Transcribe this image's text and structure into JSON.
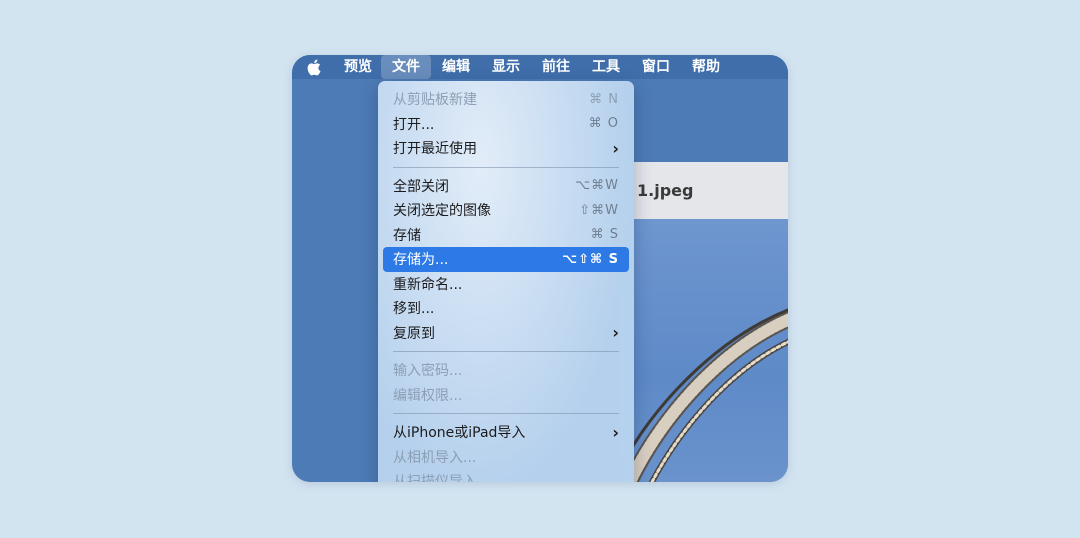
{
  "menubar": {
    "items": [
      "预览",
      "文件",
      "编辑",
      "显示",
      "前往",
      "工具",
      "窗口",
      "帮助"
    ],
    "active_item": "文件"
  },
  "document": {
    "title": "1.jpeg"
  },
  "file_menu": {
    "group1": [
      {
        "label": "从剪贴板新建",
        "shortcut": "⌘ N",
        "disabled": true
      },
      {
        "label": "打开...",
        "shortcut": "⌘ O"
      },
      {
        "label": "打开最近使用",
        "submenu": true
      }
    ],
    "group2": [
      {
        "label": "全部关闭",
        "shortcut": "⌥⌘W"
      },
      {
        "label": "关闭选定的图像",
        "shortcut": "⇧⌘W"
      },
      {
        "label": "存储",
        "shortcut": "⌘ S"
      },
      {
        "label": "存储为...",
        "shortcut": "⌥⇧⌘ S",
        "selected": true
      },
      {
        "label": "重新命名..."
      },
      {
        "label": "移到..."
      },
      {
        "label": "复原到",
        "submenu": true
      }
    ],
    "group3": [
      {
        "label": "输入密码...",
        "disabled": true
      },
      {
        "label": "编辑权限...",
        "disabled": true
      }
    ],
    "group4": [
      {
        "label": "从iPhone或iPad导入",
        "submenu": true
      },
      {
        "label": "从相机导入...",
        "disabled": true
      },
      {
        "label": "从扫描仪导入...",
        "disabled": true
      }
    ],
    "submenu_glyph": "›"
  },
  "colors": {
    "page_bg": "#d3e4f1",
    "menubar_bg": "#3f6eaa",
    "window_bg": "#4d7bb6",
    "selection": "#2d7ae6",
    "sky": "#6e96cf"
  }
}
